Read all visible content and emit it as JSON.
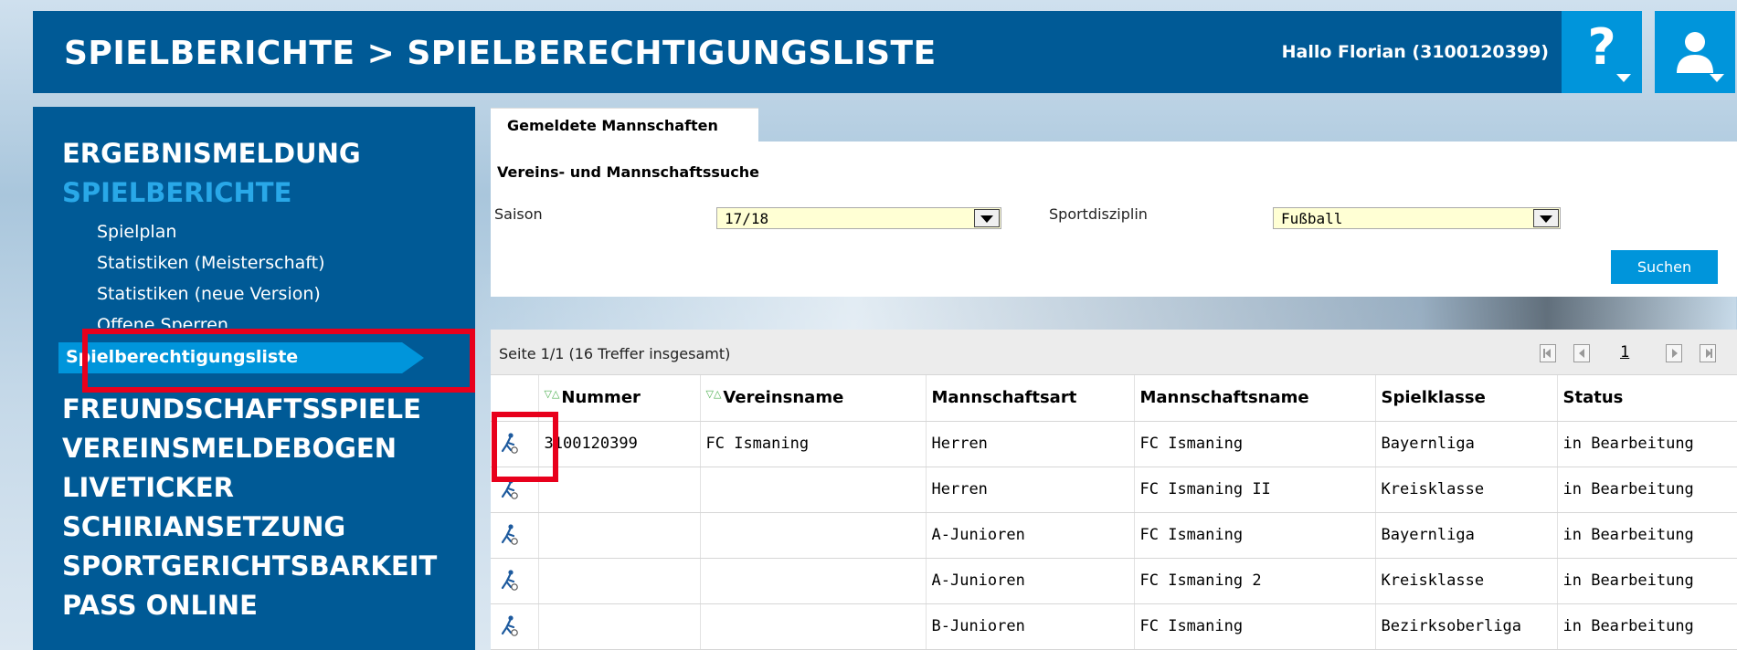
{
  "header": {
    "title": "SPIELBERICHTE > SPIELBERECHTIGUNGSLISTE",
    "greeting": "Hallo Florian (3100120399)",
    "help_label": "?"
  },
  "sidebar": {
    "main_items": [
      {
        "label": "ERGEBNISMELDUNG"
      },
      {
        "label": "SPIELBERICHTE"
      },
      {
        "label": "FREUNDSCHAFTSSPIELE"
      },
      {
        "label": "VEREINSMELDEBOGEN"
      },
      {
        "label": "LIVETICKER"
      },
      {
        "label": "SCHIRIANSETZUNG"
      },
      {
        "label": "SPORTGERICHTSBARKEIT"
      },
      {
        "label": "PASS ONLINE"
      }
    ],
    "sub_items": [
      {
        "label": "Spielplan"
      },
      {
        "label": "Statistiken (Meisterschaft)"
      },
      {
        "label": "Statistiken (neue Version)"
      },
      {
        "label": "Offene Sperren"
      },
      {
        "label": "Spielberechtigungsliste"
      }
    ]
  },
  "search": {
    "tab_label": "Gemeldete Mannschaften",
    "title": "Vereins- und Mannschaftssuche",
    "season_label": "Saison",
    "season_value": "17/18",
    "discipline_label": "Sportdisziplin",
    "discipline_value": "Fußball",
    "submit_label": "Suchen"
  },
  "results": {
    "page_info": "Seite 1/1 (16 Treffer insgesamt)",
    "current_page": "1",
    "sort_marker": "▽△",
    "columns": [
      "Nummer",
      "Vereinsname",
      "Mannschaftsart",
      "Mannschaftsname",
      "Spielklasse",
      "Status"
    ],
    "rows": [
      {
        "nummer": "3100120399",
        "verein": "FC Ismaning",
        "art": "Herren",
        "name": "FC Ismaning",
        "klasse": "Bayernliga",
        "status": "in Bearbeitung"
      },
      {
        "nummer": "",
        "verein": "",
        "art": "Herren",
        "name": "FC Ismaning II",
        "klasse": "Kreisklasse",
        "status": "in Bearbeitung"
      },
      {
        "nummer": "",
        "verein": "",
        "art": "A-Junioren",
        "name": "FC Ismaning",
        "klasse": "Bayernliga",
        "status": "in Bearbeitung"
      },
      {
        "nummer": "",
        "verein": "",
        "art": "A-Junioren",
        "name": "FC Ismaning 2",
        "klasse": "Kreisklasse",
        "status": "in Bearbeitung"
      },
      {
        "nummer": "",
        "verein": "",
        "art": "B-Junioren",
        "name": "FC Ismaning",
        "klasse": "Bezirksoberliga",
        "status": "in Bearbeitung"
      }
    ]
  },
  "colors": {
    "header_blue": "#005a96",
    "accent_blue": "#0095db",
    "active_text": "#29a8e8",
    "highlight_red": "#e8001c",
    "select_bg": "#ffffd4"
  },
  "icons": [
    "help-icon",
    "user-icon",
    "player-edit-icon",
    "dropdown-arrow-icon",
    "first-page-icon",
    "prev-page-icon",
    "next-page-icon",
    "last-page-icon",
    "sort-icon"
  ]
}
